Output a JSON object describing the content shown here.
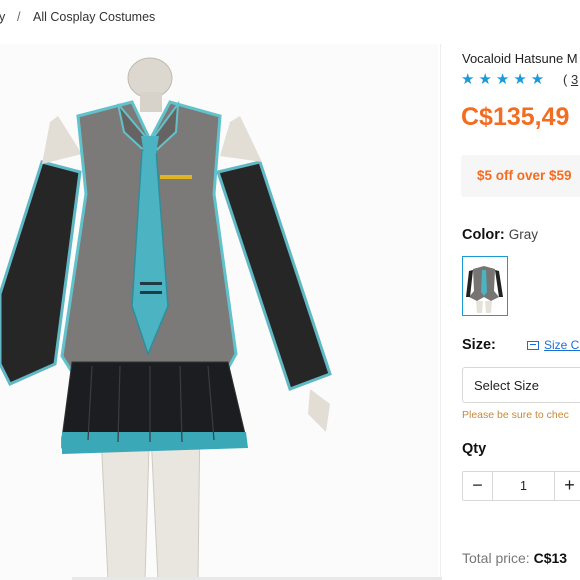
{
  "breadcrumb": {
    "prev": "y",
    "separator": "/",
    "current": "All Cosplay Costumes"
  },
  "product": {
    "title": "Vocaloid Hatsune M",
    "stars": "★★★★★",
    "review_open": "( ",
    "review_count": "3",
    "price": "C$135,49",
    "promo": "$5 off over $59"
  },
  "color": {
    "label": "Color:",
    "value": "Gray"
  },
  "size": {
    "label": "Size:",
    "chart_link": "Size Cl",
    "select_placeholder": "Select Size",
    "warning": "Please be sure to chec"
  },
  "qty": {
    "label": "Qty",
    "value": "1",
    "minus": "−",
    "plus": "+"
  },
  "total": {
    "label": "Total price: ",
    "value": "C$13"
  },
  "icons": {
    "rating": "star-icon",
    "size_chart": "ruler-icon"
  },
  "colors": {
    "accent": "#1a9bd7",
    "price": "#f26d22",
    "promo_bg": "#f6f6f6"
  }
}
